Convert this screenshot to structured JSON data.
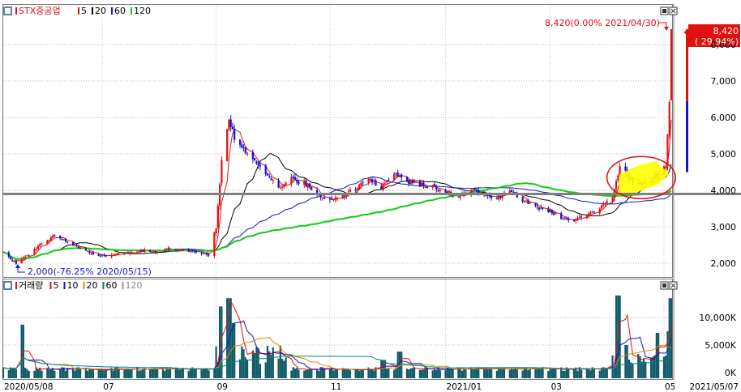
{
  "price_legend": {
    "name": "STX중공업",
    "ma": [
      {
        "label": "5",
        "color": "#e01010"
      },
      {
        "label": "20",
        "color": "#000000"
      },
      {
        "label": "60",
        "color": "#1515c8"
      },
      {
        "label": "120",
        "color": "#11cc11"
      }
    ]
  },
  "volume_legend": {
    "name": "거래량",
    "ma": [
      {
        "label": "5",
        "color": "#e01010"
      },
      {
        "label": "10",
        "color": "#1515c8"
      },
      {
        "label": "20",
        "color": "#e08a00"
      },
      {
        "label": "60",
        "color": "#008080"
      },
      {
        "label": "120",
        "color": "#9a9a9a"
      }
    ]
  },
  "annotations": {
    "high": "8,420(0.00% 2021/04/30)",
    "low": "2,000(-76.25% 2020/05/15)"
  },
  "current_price": {
    "price": "8,420",
    "change": "( 29.94%)"
  },
  "colors": {
    "up": "#e01010",
    "down": "#1515c8",
    "ma5": "#e01010",
    "ma20": "#000000",
    "ma60": "#1515c8",
    "ma120": "#11cc11",
    "vol_ma5": "#e01010",
    "vol_ma10": "#1515c8",
    "vol_ma20": "#e08a00",
    "vol_ma60": "#008080",
    "vol_bar": "#0f5a66",
    "highlight": "#ffff00",
    "support_line": "#808080",
    "circle": "#e01010"
  },
  "chart_data": [
    {
      "type": "candlestick",
      "title": "STX중공업",
      "y_ticks": [
        "2,000",
        "3,000",
        "4,000",
        "5,000",
        "6,000",
        "7,000",
        "8,000"
      ],
      "ylim": [
        1700,
        8700
      ],
      "x_ticks": [
        "2020/05/08",
        "07",
        "09",
        "11",
        "2021/01",
        "03",
        "05"
      ],
      "x_last_label": "2021/05/07",
      "period": [
        "2020/05/08",
        "2021/05/07"
      ],
      "series": [
        {
          "name": "5"
        },
        {
          "name": "20"
        },
        {
          "name": "60"
        },
        {
          "name": "120"
        }
      ],
      "price_path": [
        [
          "2020/05/08",
          2300
        ],
        [
          "2020/05/15",
          2000
        ],
        [
          "2020/05/22",
          2250
        ],
        [
          "2020/05/29",
          2550
        ],
        [
          "2020/06/05",
          2750
        ],
        [
          "2020/06/12",
          2600
        ],
        [
          "2020/06/19",
          2400
        ],
        [
          "2020/06/26",
          2250
        ],
        [
          "2020/07/03",
          2200
        ],
        [
          "2020/07/10",
          2250
        ],
        [
          "2020/07/17",
          2300
        ],
        [
          "2020/07/24",
          2350
        ],
        [
          "2020/07/31",
          2300
        ],
        [
          "2020/08/07",
          2400
        ],
        [
          "2020/08/14",
          2350
        ],
        [
          "2020/08/21",
          2300
        ],
        [
          "2020/08/28",
          2250
        ],
        [
          "2020/09/01",
          3000
        ],
        [
          "2020/09/04",
          4800
        ],
        [
          "2020/09/08",
          6000
        ],
        [
          "2020/09/11",
          5400
        ],
        [
          "2020/09/18",
          5000
        ],
        [
          "2020/09/25",
          4600
        ],
        [
          "2020/10/05",
          4100
        ],
        [
          "2020/10/12",
          4300
        ],
        [
          "2020/10/19",
          4200
        ],
        [
          "2020/10/26",
          3900
        ],
        [
          "2020/11/02",
          3750
        ],
        [
          "2020/11/09",
          3850
        ],
        [
          "2020/11/16",
          4050
        ],
        [
          "2020/11/23",
          4350
        ],
        [
          "2020/11/30",
          4050
        ],
        [
          "2020/12/07",
          4500
        ],
        [
          "2020/12/14",
          4250
        ],
        [
          "2020/12/21",
          4150
        ],
        [
          "2020/12/28",
          4100
        ],
        [
          "2021/01/04",
          3950
        ],
        [
          "2021/01/11",
          3850
        ],
        [
          "2021/01/18",
          4000
        ],
        [
          "2021/01/25",
          3900
        ],
        [
          "2021/02/01",
          3800
        ],
        [
          "2021/02/08",
          4000
        ],
        [
          "2021/02/15",
          3700
        ],
        [
          "2021/02/22",
          3550
        ],
        [
          "2021/03/01",
          3450
        ],
        [
          "2021/03/08",
          3250
        ],
        [
          "2021/03/15",
          3200
        ],
        [
          "2021/03/22",
          3300
        ],
        [
          "2021/03/29",
          3500
        ],
        [
          "2021/04/05",
          3800
        ],
        [
          "2021/04/09",
          4700
        ],
        [
          "2021/04/16",
          4200
        ],
        [
          "2021/04/23",
          4200
        ],
        [
          "2021/04/28",
          4400
        ],
        [
          "2021/05/04",
          4700
        ],
        [
          "2021/05/06",
          6500
        ],
        [
          "2021/05/07",
          8420
        ]
      ],
      "annotations": [
        {
          "text": "8,420(0.00% 2021/04/30)",
          "value": 8420
        },
        {
          "text": "2,000(-76.25% 2020/05/15)",
          "value": 2000
        }
      ],
      "reference_line": 3900,
      "current": {
        "price": 8420,
        "change_pct": 29.94
      }
    },
    {
      "type": "bar",
      "title": "거래량",
      "y_ticks": [
        "0K",
        "5,000K",
        "10,000K"
      ],
      "ylim": [
        0,
        14500000
      ],
      "series": [
        {
          "name": "5"
        },
        {
          "name": "10"
        },
        {
          "name": "20"
        },
        {
          "name": "60"
        },
        {
          "name": "120"
        }
      ],
      "spikes": [
        [
          "2020/05/18",
          8700000
        ],
        [
          "2020/09/04",
          12000000
        ],
        [
          "2020/09/08",
          13500000
        ],
        [
          "2020/09/11",
          9000000
        ],
        [
          "2020/12/01",
          2300000
        ],
        [
          "2020/12/10",
          3800000
        ],
        [
          "2021/04/08",
          14000000
        ],
        [
          "2021/04/12",
          5000000
        ],
        [
          "2021/04/30",
          7200000
        ],
        [
          "2021/05/06",
          7500000
        ],
        [
          "2021/05/07",
          13500000
        ]
      ],
      "right_indicator": {
        "red_top": 8420,
        "blue_range": [
          4500,
          6450
        ]
      }
    }
  ]
}
